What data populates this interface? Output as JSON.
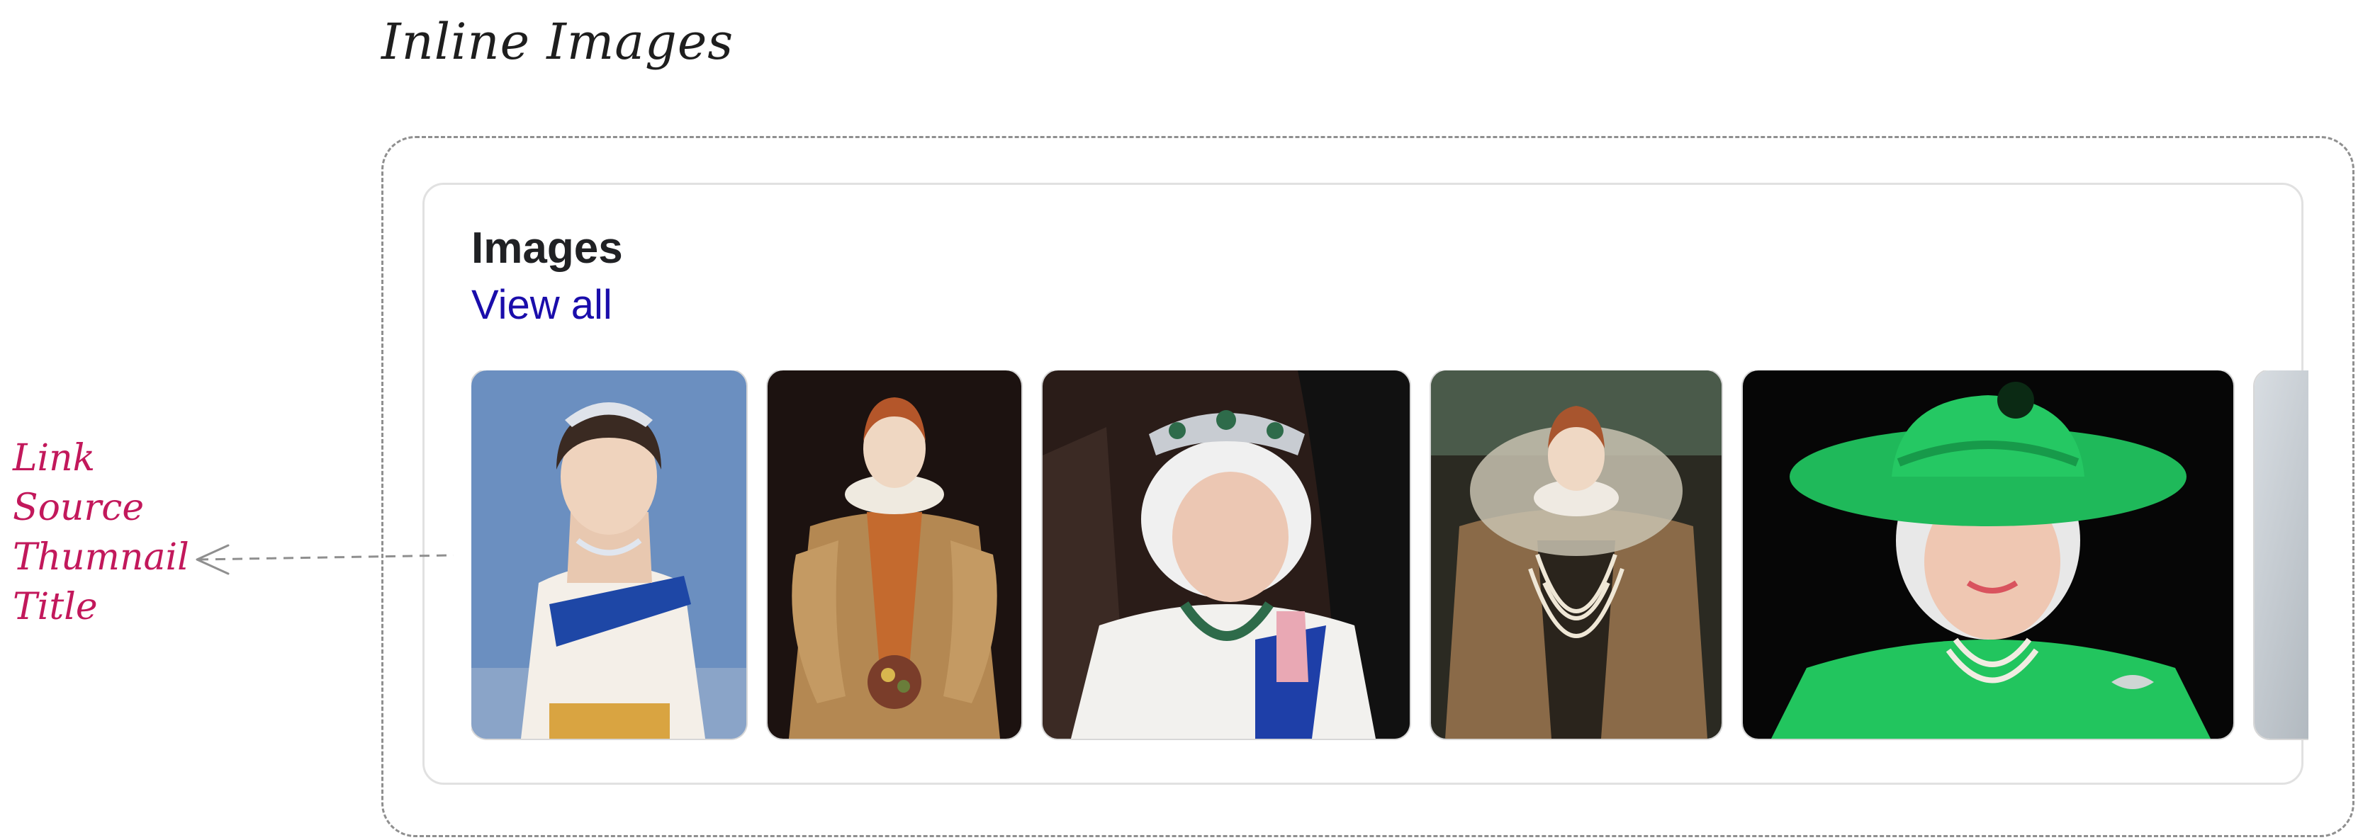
{
  "diagram": {
    "title": "Inline Images"
  },
  "card": {
    "heading": "Images",
    "view_all_label": "View all"
  },
  "annotation": {
    "labels": [
      "Link",
      "Source",
      "Thumnail",
      "Title"
    ]
  },
  "colors": {
    "link": "#1a0dab",
    "annotation": "#c2185b",
    "frame_dashed": "#8f8f8f",
    "card_border": "#e1e1e1"
  }
}
